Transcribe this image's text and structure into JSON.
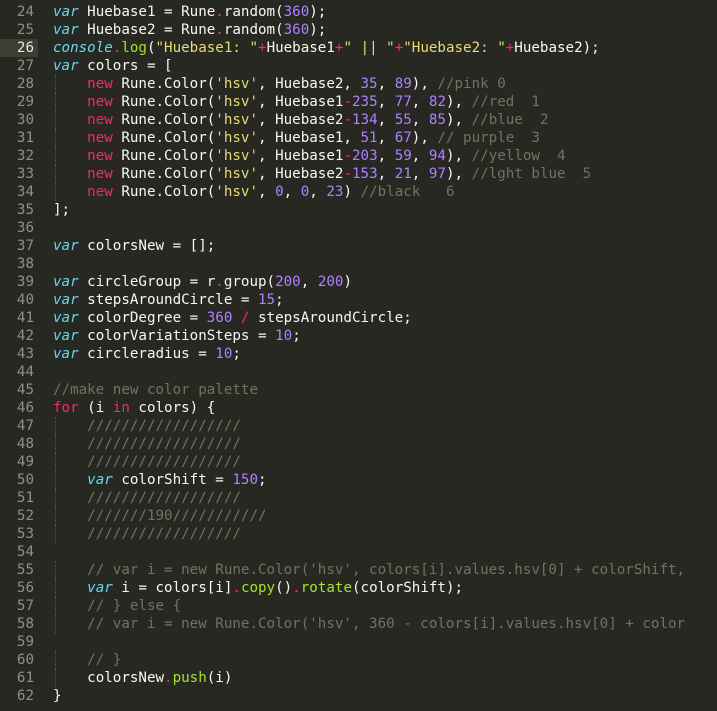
{
  "editor": {
    "theme_colors": {
      "background": "#272822",
      "gutter_text": "#8f908a",
      "keyword_italic": "#66d9ef",
      "keyword": "#f92672",
      "string": "#e6db74",
      "number": "#ae81ff",
      "comment": "#75715e",
      "function": "#a6e22e"
    },
    "active_line": 26,
    "lines": [
      {
        "no": "24",
        "tokens": [
          [
            "k",
            "var"
          ],
          [
            "p",
            " Huebase1 = Rune"
          ],
          [
            "kw",
            "."
          ],
          [
            "p",
            "random("
          ],
          [
            "n",
            "360"
          ],
          [
            "p",
            ");"
          ]
        ]
      },
      {
        "no": "25",
        "tokens": [
          [
            "k",
            "var"
          ],
          [
            "p",
            " Huebase2 = Rune"
          ],
          [
            "kw",
            "."
          ],
          [
            "p",
            "random("
          ],
          [
            "n",
            "360"
          ],
          [
            "p",
            ");"
          ]
        ]
      },
      {
        "no": "26",
        "tokens": [
          [
            "k",
            "console"
          ],
          [
            "kw",
            "."
          ],
          [
            "f",
            "log"
          ],
          [
            "p",
            "("
          ],
          [
            "s",
            "\"Huebase1: \""
          ],
          [
            "kw",
            "+"
          ],
          [
            "p",
            "Huebase1"
          ],
          [
            "kw",
            "+"
          ],
          [
            "s",
            "\" || \""
          ],
          [
            "kw",
            "+"
          ],
          [
            "s",
            "\"Huebase2: \""
          ],
          [
            "kw",
            "+"
          ],
          [
            "p",
            "Huebase2);"
          ]
        ]
      },
      {
        "no": "27",
        "tokens": [
          [
            "k",
            "var"
          ],
          [
            "p",
            " colors = ["
          ]
        ]
      },
      {
        "no": "28",
        "tokens": [
          [
            "p",
            "    "
          ],
          [
            "kw",
            "new"
          ],
          [
            "p",
            " Rune.Color("
          ],
          [
            "s",
            "'hsv'"
          ],
          [
            "p",
            ", Huebase2, "
          ],
          [
            "n",
            "35"
          ],
          [
            "p",
            ", "
          ],
          [
            "n",
            "89"
          ],
          [
            "p",
            "), "
          ],
          [
            "c",
            "//pink 0"
          ]
        ]
      },
      {
        "no": "29",
        "tokens": [
          [
            "p",
            "    "
          ],
          [
            "kw",
            "new"
          ],
          [
            "p",
            " Rune.Color("
          ],
          [
            "s",
            "'hsv'"
          ],
          [
            "p",
            ", Huebase1"
          ],
          [
            "kw",
            "-"
          ],
          [
            "n",
            "235"
          ],
          [
            "p",
            ", "
          ],
          [
            "n",
            "77"
          ],
          [
            "p",
            ", "
          ],
          [
            "n",
            "82"
          ],
          [
            "p",
            "), "
          ],
          [
            "c",
            "//red  1"
          ]
        ]
      },
      {
        "no": "30",
        "tokens": [
          [
            "p",
            "    "
          ],
          [
            "kw",
            "new"
          ],
          [
            "p",
            " Rune.Color("
          ],
          [
            "s",
            "'hsv'"
          ],
          [
            "p",
            ", Huebase2"
          ],
          [
            "kw",
            "-"
          ],
          [
            "n",
            "134"
          ],
          [
            "p",
            ", "
          ],
          [
            "n",
            "55"
          ],
          [
            "p",
            ", "
          ],
          [
            "n",
            "85"
          ],
          [
            "p",
            "), "
          ],
          [
            "c",
            "//blue  2"
          ]
        ]
      },
      {
        "no": "31",
        "tokens": [
          [
            "p",
            "    "
          ],
          [
            "kw",
            "new"
          ],
          [
            "p",
            " Rune.Color("
          ],
          [
            "s",
            "'hsv'"
          ],
          [
            "p",
            ", Huebase1, "
          ],
          [
            "n",
            "51"
          ],
          [
            "p",
            ", "
          ],
          [
            "n",
            "67"
          ],
          [
            "p",
            "), "
          ],
          [
            "c",
            "// purple  3"
          ]
        ]
      },
      {
        "no": "32",
        "tokens": [
          [
            "p",
            "    "
          ],
          [
            "kw",
            "new"
          ],
          [
            "p",
            " Rune.Color("
          ],
          [
            "s",
            "'hsv'"
          ],
          [
            "p",
            ", Huebase1"
          ],
          [
            "kw",
            "-"
          ],
          [
            "n",
            "203"
          ],
          [
            "p",
            ", "
          ],
          [
            "n",
            "59"
          ],
          [
            "p",
            ", "
          ],
          [
            "n",
            "94"
          ],
          [
            "p",
            "), "
          ],
          [
            "c",
            "//yellow  4"
          ]
        ]
      },
      {
        "no": "33",
        "tokens": [
          [
            "p",
            "    "
          ],
          [
            "kw",
            "new"
          ],
          [
            "p",
            " Rune.Color("
          ],
          [
            "s",
            "'hsv'"
          ],
          [
            "p",
            ", Huebase2"
          ],
          [
            "kw",
            "-"
          ],
          [
            "n",
            "153"
          ],
          [
            "p",
            ", "
          ],
          [
            "n",
            "21"
          ],
          [
            "p",
            ", "
          ],
          [
            "n",
            "97"
          ],
          [
            "p",
            "), "
          ],
          [
            "c",
            "//lght blue  5"
          ]
        ]
      },
      {
        "no": "34",
        "tokens": [
          [
            "p",
            "    "
          ],
          [
            "kw",
            "new"
          ],
          [
            "p",
            " Rune.Color("
          ],
          [
            "s",
            "'hsv'"
          ],
          [
            "p",
            ", "
          ],
          [
            "n",
            "0"
          ],
          [
            "p",
            ", "
          ],
          [
            "n",
            "0"
          ],
          [
            "p",
            ", "
          ],
          [
            "n",
            "23"
          ],
          [
            "p",
            ") "
          ],
          [
            "c",
            "//black   6"
          ]
        ]
      },
      {
        "no": "35",
        "tokens": [
          [
            "p",
            "];"
          ]
        ]
      },
      {
        "no": "36",
        "tokens": []
      },
      {
        "no": "37",
        "tokens": [
          [
            "k",
            "var"
          ],
          [
            "p",
            " colorsNew = [];"
          ]
        ]
      },
      {
        "no": "38",
        "tokens": []
      },
      {
        "no": "39",
        "tokens": [
          [
            "k",
            "var"
          ],
          [
            "p",
            " circleGroup = r"
          ],
          [
            "kw",
            "."
          ],
          [
            "p",
            "group("
          ],
          [
            "n",
            "200"
          ],
          [
            "p",
            ", "
          ],
          [
            "n",
            "200"
          ],
          [
            "p",
            ")"
          ]
        ]
      },
      {
        "no": "40",
        "tokens": [
          [
            "k",
            "var"
          ],
          [
            "p",
            " stepsAroundCircle = "
          ],
          [
            "n",
            "15"
          ],
          [
            "p",
            ";"
          ]
        ]
      },
      {
        "no": "41",
        "tokens": [
          [
            "k",
            "var"
          ],
          [
            "p",
            " colorDegree = "
          ],
          [
            "n",
            "360"
          ],
          [
            "p",
            " "
          ],
          [
            "kw",
            "/"
          ],
          [
            "p",
            " stepsAroundCircle;"
          ]
        ]
      },
      {
        "no": "42",
        "tokens": [
          [
            "k",
            "var"
          ],
          [
            "p",
            " colorVariationSteps = "
          ],
          [
            "n",
            "10"
          ],
          [
            "p",
            ";"
          ]
        ]
      },
      {
        "no": "43",
        "tokens": [
          [
            "k",
            "var"
          ],
          [
            "p",
            " circleradius = "
          ],
          [
            "n",
            "10"
          ],
          [
            "p",
            ";"
          ]
        ]
      },
      {
        "no": "44",
        "tokens": []
      },
      {
        "no": "45",
        "tokens": [
          [
            "c",
            "//make new color palette"
          ]
        ]
      },
      {
        "no": "46",
        "tokens": [
          [
            "kw",
            "for"
          ],
          [
            "p",
            " (i "
          ],
          [
            "kw",
            "in"
          ],
          [
            "p",
            " colors) {"
          ]
        ]
      },
      {
        "no": "47",
        "tokens": [
          [
            "p",
            "    "
          ],
          [
            "c",
            "//////////////////"
          ]
        ]
      },
      {
        "no": "48",
        "tokens": [
          [
            "p",
            "    "
          ],
          [
            "c",
            "//////////////////"
          ]
        ]
      },
      {
        "no": "49",
        "tokens": [
          [
            "p",
            "    "
          ],
          [
            "c",
            "//////////////////"
          ]
        ]
      },
      {
        "no": "50",
        "tokens": [
          [
            "p",
            "    "
          ],
          [
            "k",
            "var"
          ],
          [
            "p",
            " colorShift = "
          ],
          [
            "n",
            "150"
          ],
          [
            "p",
            ";"
          ]
        ]
      },
      {
        "no": "51",
        "tokens": [
          [
            "p",
            "    "
          ],
          [
            "c",
            "//////////////////"
          ]
        ]
      },
      {
        "no": "52",
        "tokens": [
          [
            "p",
            "    "
          ],
          [
            "c",
            "///////190///////////"
          ]
        ]
      },
      {
        "no": "53",
        "tokens": [
          [
            "p",
            "    "
          ],
          [
            "c",
            "//////////////////"
          ]
        ]
      },
      {
        "no": "54",
        "tokens": []
      },
      {
        "no": "55",
        "tokens": [
          [
            "p",
            "    "
          ],
          [
            "c",
            "// var i = new Rune.Color('hsv', colors[i].values.hsv[0] + colorShift,"
          ]
        ]
      },
      {
        "no": "56",
        "tokens": [
          [
            "p",
            "    "
          ],
          [
            "k",
            "var"
          ],
          [
            "p",
            " i = colors[i]"
          ],
          [
            "kw",
            "."
          ],
          [
            "f",
            "copy"
          ],
          [
            "p",
            "()"
          ],
          [
            "kw",
            "."
          ],
          [
            "f",
            "rotate"
          ],
          [
            "p",
            "(colorShift);"
          ]
        ]
      },
      {
        "no": "57",
        "tokens": [
          [
            "p",
            "    "
          ],
          [
            "c",
            "// } else {"
          ]
        ]
      },
      {
        "no": "58",
        "tokens": [
          [
            "p",
            "    "
          ],
          [
            "c",
            "// var i = new Rune.Color('hsv', 360 - colors[i].values.hsv[0] + color"
          ]
        ]
      },
      {
        "no": "59",
        "tokens": []
      },
      {
        "no": "60",
        "tokens": [
          [
            "p",
            "    "
          ],
          [
            "c",
            "// }"
          ]
        ]
      },
      {
        "no": "61",
        "tokens": [
          [
            "p",
            "    colorsNew"
          ],
          [
            "kw",
            "."
          ],
          [
            "f",
            "push"
          ],
          [
            "p",
            "(i)"
          ]
        ]
      },
      {
        "no": "62",
        "tokens": [
          [
            "p",
            "}"
          ]
        ]
      }
    ]
  }
}
